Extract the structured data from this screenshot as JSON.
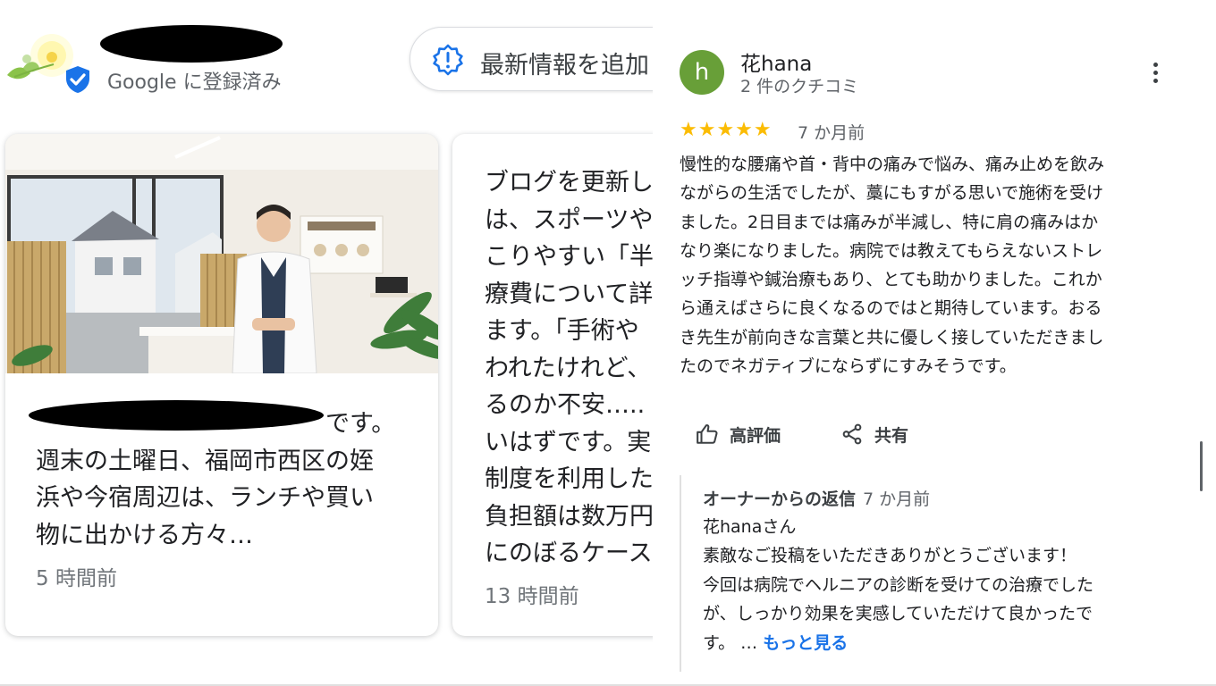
{
  "profile": {
    "verified_label": "Google に登録済み",
    "update_button_label": "最新情報を追加",
    "icons": {
      "logo": "flower-logo",
      "badge": "verified-shield-icon",
      "update": "alert-badge-icon"
    }
  },
  "posts": [
    {
      "lines": [
        "です。",
        "週末の土曜日、福岡市西区の姪",
        "浜や今宿周辺は、ランチや買い",
        "物に出かける方々…"
      ],
      "time": "5 時間前",
      "image": "clinic-photo"
    },
    {
      "lines": [
        "ブログを更新し",
        "は、スポーツや",
        "こりやすい「半",
        "療費について詳",
        "ます。「手術や",
        "われたけれど、",
        "るのか不安…..",
        "いはずです。実",
        "制度を利用した",
        "負担額は数万円",
        "にのぼるケース"
      ],
      "time": "13 時間前"
    }
  ],
  "review": {
    "avatar_letter": "h",
    "avatar_color": "#689f38",
    "author": "花hana",
    "review_count": "2 件のクチコミ",
    "stars": "★★★★★",
    "rating": 5,
    "date": "7 か月前",
    "text_lines": [
      "慢性的な腰痛や首・背中の痛みで悩み、痛み止めを飲み",
      "ながらの生活でしたが、藁にもすがる思いで施術を受け",
      "ました。2日目までは痛みが半減し、特に肩の痛みはか",
      "なり楽になりました。病院では教えてもらえないストレ",
      "ッチ指導や鍼治療もあり、とても助かりました。これか",
      "ら通えばさらに良くなるのではと期待しています。おる",
      "き先生が前向きな言葉と共に優しく接していただきまし",
      "たのでネガティブにならずにすみそうです。"
    ],
    "like_label": "高評価",
    "share_label": "共有",
    "owner_reply": {
      "heading": "オーナーからの返信",
      "date": "7 か月前",
      "lines": [
        "花hanaさん",
        "素敵なご投稿をいただきありがとうございます！",
        "今回は病院でヘルニアの診断を受けての治療でした",
        "が、しっかり効果を実感していただけて良かったで"
      ],
      "last_line_prefix": "す。 … ",
      "more_label": "もっと見る"
    },
    "icons": {
      "menu": "more-vert-icon",
      "like": "thumb-up-icon",
      "share": "share-icon"
    }
  },
  "colors": {
    "star": "#fbbc04",
    "accent": "#1a73e8",
    "verified": "#1a73e8"
  }
}
